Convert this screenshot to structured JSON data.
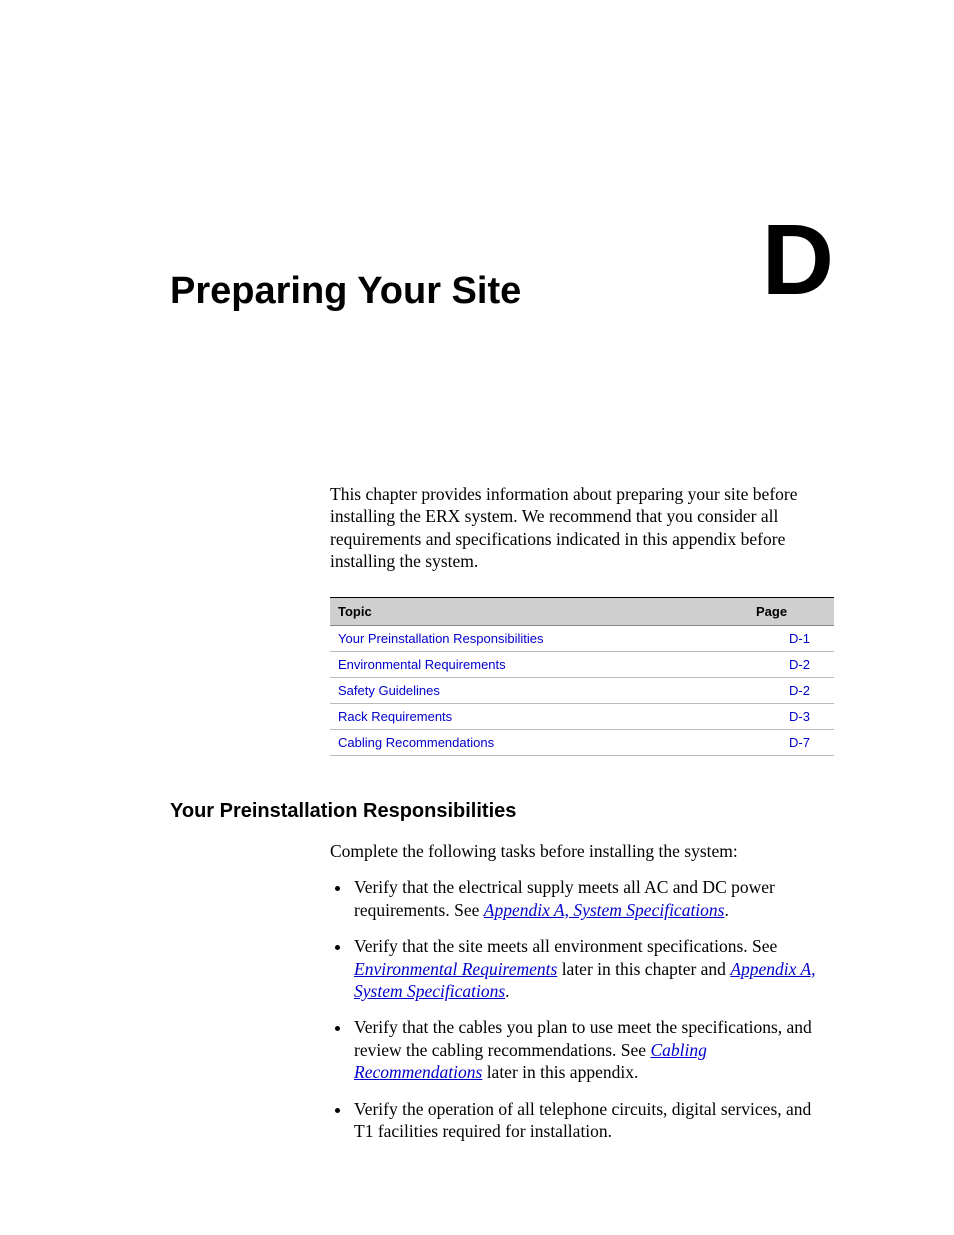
{
  "chapter": {
    "letter": "D",
    "title": "Preparing Your Site"
  },
  "intro": "This chapter provides information about preparing your site before installing the ERX system. We recommend that you consider all requirements and specifications indicated in this appendix before installing the system.",
  "toc": {
    "headers": {
      "topic": "Topic",
      "page": "Page"
    },
    "rows": [
      {
        "topic": "Your Preinstallation Responsibilities",
        "page": "D-1"
      },
      {
        "topic": "Environmental Requirements",
        "page": "D-2"
      },
      {
        "topic": "Safety Guidelines",
        "page": "D-2"
      },
      {
        "topic": "Rack Requirements",
        "page": "D-3"
      },
      {
        "topic": "Cabling Recommendations",
        "page": "D-7"
      }
    ]
  },
  "section": {
    "heading": "Your Preinstallation Responsibilities",
    "intro": "Complete the following tasks before installing the system:",
    "bullets": [
      {
        "pre": "Verify that the electrical supply meets all AC and DC power requirements. See ",
        "xref": "Appendix A, System Specifications",
        "post": "."
      },
      {
        "pre": "Verify that the site meets all environment specifications. See ",
        "xref": "Environmental Requirements",
        "mid": " later in this chapter and ",
        "xref2": "Appendix A, System Specifications",
        "post": "."
      },
      {
        "pre": "Verify that the cables you plan to use meet the specifications, and review the cabling recommendations. See ",
        "xref": "Cabling Recommendations",
        "post": " later in this appendix."
      },
      {
        "pre": "Verify the operation of all telephone circuits, digital services, and T1 facilities required for installation."
      }
    ]
  }
}
